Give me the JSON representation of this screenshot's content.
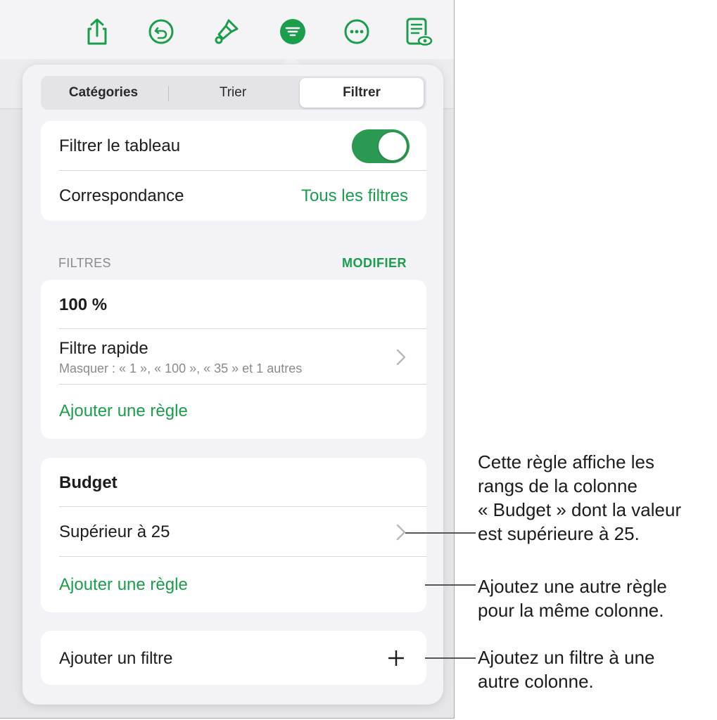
{
  "toolbar": {
    "icons": [
      "share-icon",
      "undo-icon",
      "paintbrush-icon",
      "filter-icon",
      "more-icon",
      "reader-view-icon"
    ],
    "accent": "#1a9e4c"
  },
  "tabs": {
    "categories": "Catégories",
    "sort": "Trier",
    "filter": "Filtrer",
    "active": "Filtrer"
  },
  "filter_table": {
    "label": "Filtrer le tableau",
    "enabled": true
  },
  "match": {
    "label": "Correspondance",
    "value": "Tous les filtres"
  },
  "filters_section": {
    "header": "FILTRES",
    "edit": "MODIFIER"
  },
  "filter1": {
    "column": "100 %",
    "rule_title": "Filtre rapide",
    "rule_detail": "Masquer : « 1 », « 100 », « 35 » et 1 autres",
    "add_rule": "Ajouter une règle"
  },
  "filter2": {
    "column": "Budget",
    "rule_title": "Supérieur à 25",
    "add_rule": "Ajouter une règle"
  },
  "add_filter": {
    "label": "Ajouter un filtre",
    "icon": "plus-icon"
  },
  "callouts": {
    "rule": [
      "Cette règle affiche les",
      "rangs de la colonne",
      "« Budget » dont la valeur",
      "est supérieure à 25."
    ],
    "add_rule": [
      "Ajoutez une autre règle",
      "pour la même colonne."
    ],
    "add_filter": [
      "Ajoutez un filtre à une",
      "autre colonne."
    ]
  },
  "colors": {
    "green": "#1a9e4c",
    "toggle_on": "#2a9a52",
    "panel_bg": "#f2f2f7"
  }
}
